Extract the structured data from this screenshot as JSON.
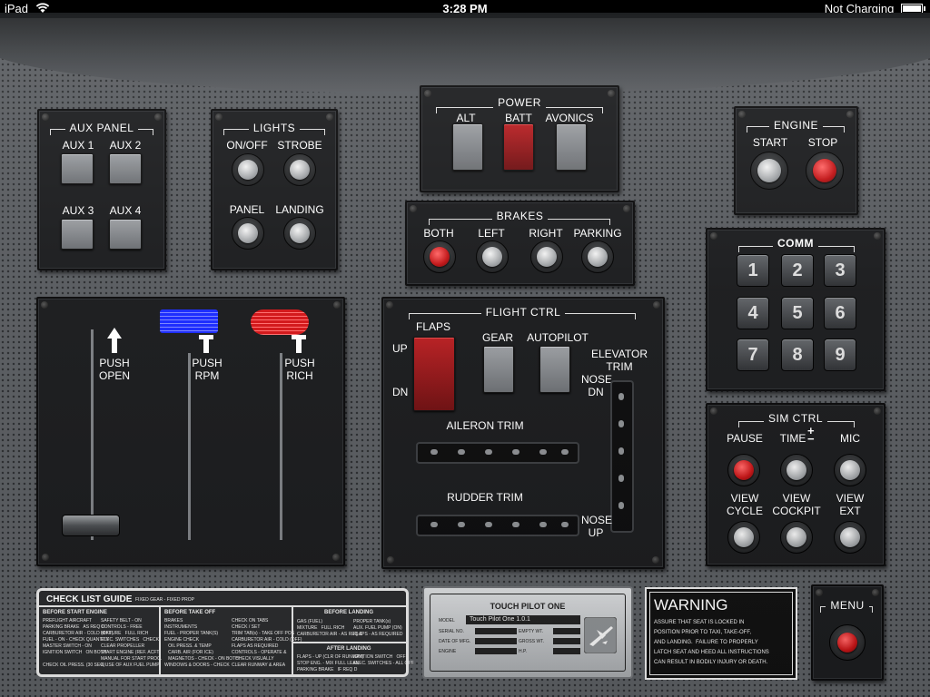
{
  "status_bar": {
    "device": "iPad",
    "time": "3:28 PM",
    "battery": "Not Charging"
  },
  "aux_panel": {
    "title": "AUX PANEL",
    "buttons": [
      "AUX 1",
      "AUX 2",
      "AUX 3",
      "AUX 4"
    ]
  },
  "lights": {
    "title": "LIGHTS",
    "buttons": [
      "ON/OFF",
      "STROBE",
      "PANEL",
      "LANDING"
    ]
  },
  "power": {
    "title": "POWER",
    "buttons": [
      "ALT",
      "BATT",
      "AVONICS"
    ]
  },
  "brakes": {
    "title": "BRAKES",
    "buttons": [
      "BOTH",
      "LEFT",
      "RIGHT",
      "PARKING"
    ]
  },
  "engine": {
    "title": "ENGINE",
    "buttons": [
      "START",
      "STOP"
    ]
  },
  "comm": {
    "title": "COMM",
    "keys": [
      "1",
      "2",
      "3",
      "4",
      "5",
      "6",
      "7",
      "8",
      "9"
    ]
  },
  "throttle": {
    "levers": [
      {
        "line1": "PUSH",
        "line2": "OPEN"
      },
      {
        "line1": "PUSH",
        "line2": "RPM"
      },
      {
        "line1": "PUSH",
        "line2": "RICH"
      }
    ]
  },
  "flight_ctrl": {
    "title": "FLIGHT CTRL",
    "flaps": "FLAPS",
    "up": "UP",
    "dn": "DN",
    "gear": "GEAR",
    "autopilot": "AUTOPILOT",
    "elevator_trim_1": "ELEVATOR",
    "elevator_trim_2": "TRIM",
    "nose_dn_1": "NOSE",
    "nose_dn_2": "DN",
    "aileron_trim": "AILERON TRIM",
    "rudder_trim": "RUDDER TRIM",
    "nose_up_1": "NOSE",
    "nose_up_2": "UP"
  },
  "sim_ctrl": {
    "title": "SIM CTRL",
    "row1": [
      "PAUSE",
      "TIME",
      "MIC"
    ],
    "plus_minus": "+\n−",
    "row2": [
      {
        "line1": "VIEW",
        "line2": "CYCLE"
      },
      {
        "line1": "VIEW",
        "line2": "COCKPIT"
      },
      {
        "line1": "VIEW",
        "line2": "EXT"
      }
    ]
  },
  "checklist": {
    "title": "CHECK LIST GUIDE",
    "subtitle": "FIXED GEAR - FIXED PROP",
    "before_start": {
      "heading": "BEFORE START ENGINE",
      "col1": [
        "PREFLIGHT AIRCRAFT",
        "PARKING BRAKE   AS REQ D",
        "CARBURETOR AIR - COLD (OFF)",
        "FUEL - ON - CHECK QUANTITY",
        "MASTER SWITCH - ON",
        "IGNITION SWITCH   ON BOTH",
        "",
        "CHECK OIL PRESS. (30 SEC)"
      ],
      "col2": [
        "SAFETY BELT - ON",
        "CONTROLS - FREE",
        "MIXTURE   FULL RICH",
        "ELEC. SWITCHES   CHECK",
        "CLEAR PROPELLER",
        "START ENGINE (REF. ACFT",
        "MANUAL FOR START PROC.",
        "& USE OF AUX FUEL PUMP)"
      ]
    },
    "before_takeoff": {
      "heading": "BEFORE TAKE OFF",
      "col1": [
        "BRAKES",
        "INSTRUMENTS",
        "FUEL - PROPER TANK(S)",
        "ENGINE CHECK",
        "   OIL PRESS. & TEMP",
        "   CARB. AIR (FOR ICE)",
        "   MAGNETOS - CHECK - ON BOTH",
        "WINDOWS & DOORS - CHECK"
      ],
      "col2": [
        "CHECK ON TABS",
        "CHECK / SET",
        "TRIM TAB(s) - TAKE OFF POS",
        "CARBURETOR AIR - COLD (OFF)",
        "FLAPS AS REQUIRED",
        "CONTROLS - OPERATE &",
        "   CHECK VISUALLY",
        "CLEAR RUNWAY & AREA"
      ]
    },
    "before_landing": {
      "heading": "BEFORE LANDING",
      "col1": [
        "GAS (FUEL)",
        "MIXTURE   FULL RICH",
        "CARBURETOR AIR - AS REQ D"
      ],
      "col2": [
        "PROPER TANK(s)",
        "AUX. FUEL PUMP (ON)",
        "FLAPS - AS REQUIRED"
      ]
    },
    "after_landing": {
      "heading": "AFTER LANDING",
      "col1": [
        "FLAPS - UP (CLR OF RUNWAY)",
        "STOP ENG. - MIX FULL LEAN",
        "PARKING BRAKE   IF REQ D"
      ],
      "col2": [
        "IGNITION SWITCH   OFF",
        "ELEC. SWITCHES - ALL OFF"
      ]
    }
  },
  "data_plate": {
    "title": "TOUCH PILOT ONE",
    "model_label": "MODEL",
    "model_value": "Touch Pilot One 1.0.1",
    "serial": "SERIAL NO.",
    "empty_wt": "EMPTY WT.",
    "date": "DATE OF MFG.",
    "gross_wt": "GROSS WT.",
    "engine": "ENGINE",
    "hp": "H.P."
  },
  "warning": {
    "title": "WARNING",
    "lines": [
      "ASSURE THAT SEAT IS LOCKED IN",
      "POSITION PRIOR TO TAXI, TAKE-OFF,",
      "AND LANDING.  FAILURE TO PROPERLY",
      "LATCH SEAT AND HEED ALL INSTRUCTIONS",
      "CAN RESULT IN BODILY INJURY OR DEATH."
    ]
  },
  "menu": {
    "title": "MENU"
  },
  "colors": {
    "panel": "#595c60",
    "box": "#1b1c1e",
    "red": "#c11416",
    "blue": "#1a2bff"
  }
}
